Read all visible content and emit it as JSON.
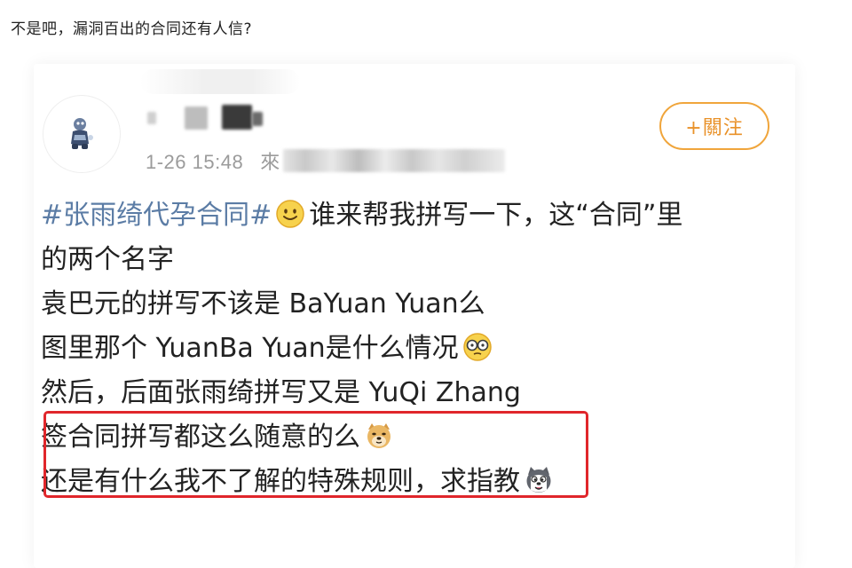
{
  "article": {
    "title": "不是吧，漏洞百出的合同还有人信?"
  },
  "post": {
    "author_name": "",
    "timestamp": "1-26 15:48",
    "source_prefix": "來",
    "follow_label": "+關注",
    "lines": [
      {
        "hashtag": "#张雨绮代孕合同#",
        "text": "谁来帮我拼写一下，这“合同”里",
        "emoji": "smile-emoji"
      },
      {
        "text": "的两个名字"
      },
      {
        "text": "袁巴元的拼写不该是 BaYuan Yuan么"
      },
      {
        "text": "图里那个 YuanBa Yuan是什么情况",
        "emoji": "glasses-emoji"
      },
      {
        "text": "然后，后面张雨绮拼写又是 YuQi Zhang"
      },
      {
        "text": "签合同拼写都这么随意的么",
        "emoji": "doge-emoji"
      },
      {
        "text": "还是有什么我不了解的特殊规则，求指教",
        "emoji": "husky-emoji"
      }
    ]
  },
  "colors": {
    "hashtag": "#5b7ca5",
    "follow": "#e9922a",
    "highlight_border": "#e0262b",
    "meta_text": "#9b9b9b"
  }
}
